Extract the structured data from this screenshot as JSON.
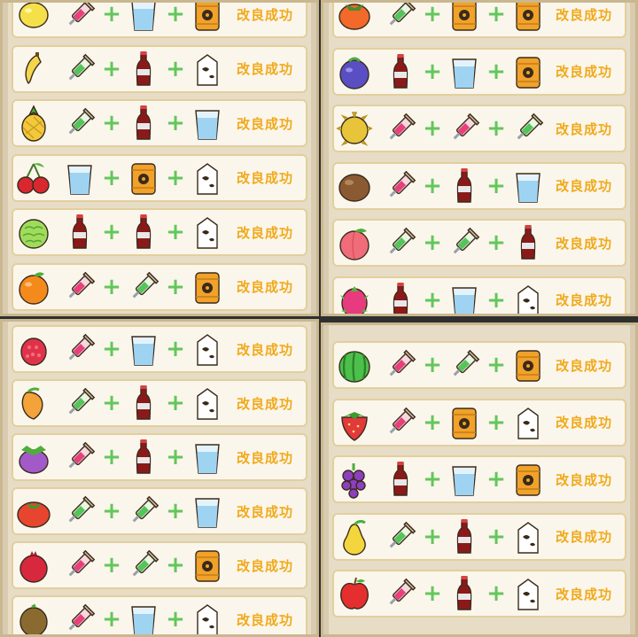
{
  "success_label": "改良成功",
  "plus_symbol": "+",
  "panels": [
    {
      "name": "top-left",
      "rows": [
        {
          "fruit": "lemon-icon",
          "ingredients": [
            "syringe-pink-icon",
            "water-glass-icon",
            "radioactive-barrel-icon"
          ]
        },
        {
          "fruit": "banana-icon",
          "ingredients": [
            "syringe-green-icon",
            "cola-bottle-icon",
            "milk-carton-icon"
          ]
        },
        {
          "fruit": "pineapple-icon",
          "ingredients": [
            "syringe-green-icon",
            "cola-bottle-icon",
            "water-glass-icon"
          ]
        },
        {
          "fruit": "cherry-icon",
          "ingredients": [
            "water-glass-icon",
            "radioactive-barrel-icon",
            "milk-carton-icon"
          ]
        },
        {
          "fruit": "custard-apple-icon",
          "ingredients": [
            "cola-bottle-icon",
            "cola-bottle-icon",
            "milk-carton-icon"
          ]
        },
        {
          "fruit": "orange-icon",
          "ingredients": [
            "syringe-pink-icon",
            "syringe-green-icon",
            "radioactive-barrel-icon"
          ]
        }
      ]
    },
    {
      "name": "top-right",
      "rows": [
        {
          "fruit": "persimmon-icon",
          "ingredients": [
            "syringe-green-icon",
            "radioactive-barrel-icon",
            "radioactive-barrel-icon"
          ]
        },
        {
          "fruit": "blueberry-icon",
          "ingredients": [
            "cola-bottle-icon",
            "water-glass-icon",
            "radioactive-barrel-icon"
          ]
        },
        {
          "fruit": "durian-icon",
          "ingredients": [
            "syringe-pink-icon",
            "syringe-pink-icon",
            "syringe-green-icon"
          ]
        },
        {
          "fruit": "coconut-icon",
          "ingredients": [
            "syringe-pink-icon",
            "cola-bottle-icon",
            "water-glass-icon"
          ]
        },
        {
          "fruit": "peach-icon",
          "ingredients": [
            "syringe-green-icon",
            "syringe-green-icon",
            "cola-bottle-icon"
          ]
        },
        {
          "fruit": "dragon-fruit-icon",
          "ingredients": [
            "cola-bottle-icon",
            "water-glass-icon",
            "milk-carton-icon"
          ]
        }
      ]
    },
    {
      "name": "bottom-left",
      "rows": [
        {
          "fruit": "raspberry-icon",
          "ingredients": [
            "syringe-pink-icon",
            "water-glass-icon",
            "milk-carton-icon"
          ]
        },
        {
          "fruit": "mango-icon",
          "ingredients": [
            "syringe-green-icon",
            "cola-bottle-icon",
            "milk-carton-icon"
          ]
        },
        {
          "fruit": "mangosteen-icon",
          "ingredients": [
            "syringe-pink-icon",
            "cola-bottle-icon",
            "water-glass-icon"
          ]
        },
        {
          "fruit": "tomato-icon",
          "ingredients": [
            "syringe-green-icon",
            "syringe-green-icon",
            "water-glass-icon"
          ]
        },
        {
          "fruit": "pomegranate-icon",
          "ingredients": [
            "syringe-pink-icon",
            "syringe-green-icon",
            "radioactive-barrel-icon"
          ]
        },
        {
          "fruit": "kiwi-icon",
          "ingredients": [
            "syringe-pink-icon",
            "water-glass-icon",
            "milk-carton-icon"
          ]
        }
      ]
    },
    {
      "name": "bottom-right",
      "rows": [
        {
          "fruit": "watermelon-icon",
          "ingredients": [
            "syringe-pink-icon",
            "syringe-green-icon",
            "radioactive-barrel-icon"
          ]
        },
        {
          "fruit": "strawberry-icon",
          "ingredients": [
            "syringe-pink-icon",
            "radioactive-barrel-icon",
            "milk-carton-icon"
          ]
        },
        {
          "fruit": "grape-icon",
          "ingredients": [
            "cola-bottle-icon",
            "water-glass-icon",
            "radioactive-barrel-icon"
          ]
        },
        {
          "fruit": "pear-icon",
          "ingredients": [
            "syringe-green-icon",
            "cola-bottle-icon",
            "milk-carton-icon"
          ]
        },
        {
          "fruit": "apple-icon",
          "ingredients": [
            "syringe-pink-icon",
            "cola-bottle-icon",
            "milk-carton-icon"
          ]
        }
      ]
    }
  ],
  "colors": {
    "success_text": "#f0aa1c",
    "plus": "#62c75b",
    "row_bg": "#fbf6ec",
    "row_border": "#e2cf9d",
    "panel_bg": "#e7dcc5"
  }
}
